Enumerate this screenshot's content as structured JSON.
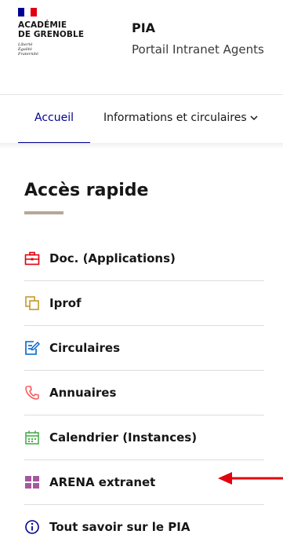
{
  "header": {
    "logo": {
      "flag_colors": [
        "#000091",
        "#ffffff",
        "#e1000f"
      ],
      "title_line1": "ACADÉMIE",
      "title_line2": "DE GRENOBLE",
      "motto_line1": "Liberté",
      "motto_line2": "Égalité",
      "motto_line3": "Fraternité"
    },
    "service_name": "PIA",
    "service_tagline": "Portail Intranet Agents"
  },
  "nav": {
    "items": [
      {
        "label": "Accueil",
        "active": true
      },
      {
        "label": "Informations et circulaires",
        "has_dropdown": true,
        "icon": "chevron-down-icon"
      }
    ]
  },
  "main": {
    "section_title": "Accès rapide",
    "quick_links": [
      {
        "label": "Doc. (Applications)",
        "icon": "briefcase-icon",
        "color": "#e1000f"
      },
      {
        "label": "Iprof",
        "icon": "copy-icon",
        "color": "#c3992a"
      },
      {
        "label": "Circulaires",
        "icon": "edit-document-icon",
        "color": "#0063cb"
      },
      {
        "label": "Annuaires",
        "icon": "phone-icon",
        "color": "#f95c5e"
      },
      {
        "label": "Calendrier (Instances)",
        "icon": "calendar-icon",
        "color": "#4caf50"
      },
      {
        "label": "ARENA extranet",
        "icon": "grid-icon",
        "color": "#a558a0"
      },
      {
        "label": "Tout savoir sur le PIA",
        "icon": "info-icon",
        "color": "#000091"
      }
    ]
  },
  "annotation": {
    "icon": "red-arrow-icon",
    "color": "#e1000f"
  },
  "colors": {
    "accent": "#000091",
    "title_underline": "#b7a79a"
  }
}
